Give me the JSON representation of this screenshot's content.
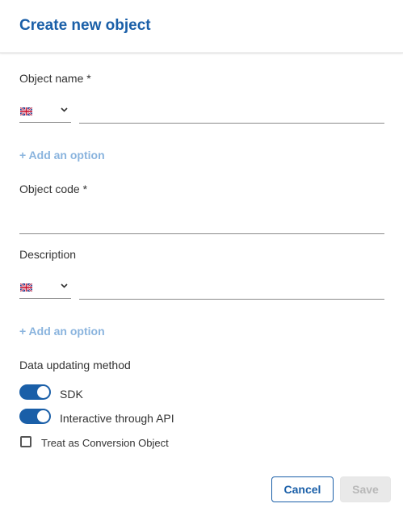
{
  "dialog": {
    "title": "Create new object"
  },
  "form": {
    "object_name": {
      "label": "Object name *",
      "language": {
        "flag": "uk-flag-icon",
        "selected": "English"
      },
      "value": "",
      "add_option": "+ Add an option"
    },
    "object_code": {
      "label": "Object code *",
      "value": ""
    },
    "description": {
      "label": "Description",
      "language": {
        "flag": "uk-flag-icon",
        "selected": "English"
      },
      "value": "",
      "add_option": "+ Add an option"
    },
    "data_updating": {
      "label": "Data updating method",
      "options": [
        {
          "label": "SDK",
          "enabled": true
        },
        {
          "label": "Interactive through API",
          "enabled": true
        }
      ]
    },
    "conversion": {
      "label": "Treat as Conversion Object",
      "checked": false
    }
  },
  "actions": {
    "cancel_label": "Cancel",
    "save_label": "Save",
    "save_disabled": true
  },
  "colors": {
    "primary": "#1a5fa8",
    "link": "#8ab4de",
    "disabled_bg": "#e9e9e9"
  }
}
